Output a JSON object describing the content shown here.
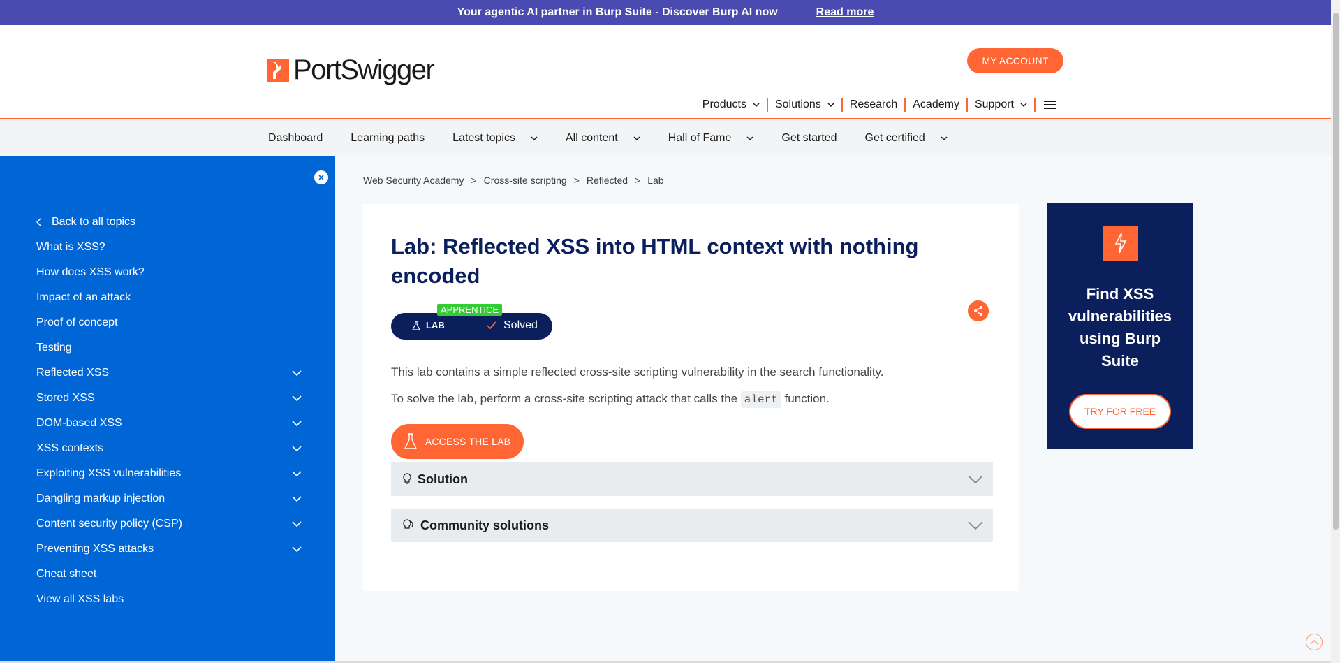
{
  "banner": {
    "text": "Your agentic AI partner in Burp Suite - Discover Burp AI now",
    "link": "Read more"
  },
  "header": {
    "logo_text": "PortSwigger",
    "my_account": "MY ACCOUNT",
    "nav": [
      "Products",
      "Solutions",
      "Research",
      "Academy",
      "Support"
    ]
  },
  "subnav": [
    "Dashboard",
    "Learning paths",
    "Latest topics",
    "All content",
    "Hall of Fame",
    "Get started",
    "Get certified"
  ],
  "sidebar": {
    "back": "Back to all topics",
    "items": [
      "What is XSS?",
      "How does XSS work?",
      "Impact of an attack",
      "Proof of concept",
      "Testing",
      "Reflected XSS",
      "Stored XSS",
      "DOM-based XSS",
      "XSS contexts",
      "Exploiting XSS vulnerabilities",
      "Dangling markup injection",
      "Content security policy (CSP)",
      "Preventing XSS attacks",
      "Cheat sheet",
      "View all XSS labs"
    ]
  },
  "breadcrumb": [
    "Web Security Academy",
    ">",
    "Cross-site scripting",
    ">",
    "Reflected",
    ">",
    "Lab"
  ],
  "lab": {
    "title": "Lab: Reflected XSS into HTML context with nothing encoded",
    "level": "APPRENTICE",
    "lab_label": "LAB",
    "status": "Solved",
    "desc1": "This lab contains a simple reflected cross-site scripting vulnerability in the search functionality.",
    "desc2_pre": "To solve the lab, perform a cross-site scripting attack that calls the",
    "desc2_code": "alert",
    "desc2_post": "function.",
    "access": "ACCESS THE LAB",
    "solution": "Solution",
    "community": "Community solutions"
  },
  "promo": {
    "text": "Find XSS vulnerabilities using Burp Suite",
    "button": "TRY FOR FREE"
  },
  "colors": {
    "accent": "#ff6633",
    "navy": "#0a1f5c",
    "sidebar": "#0066d6",
    "banner": "#4a4bb0"
  }
}
